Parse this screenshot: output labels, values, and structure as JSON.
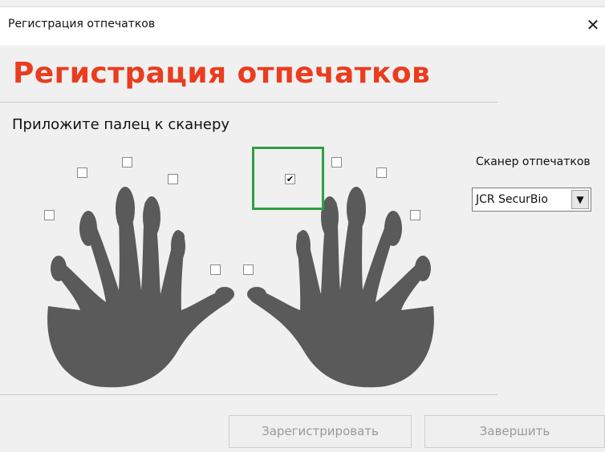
{
  "window": {
    "title": "Регистрация отпечатков",
    "close_glyph": "✕"
  },
  "header": {
    "title": "Регистрация отпечатков"
  },
  "prompt": "Приложите палец к сканеру",
  "scanner": {
    "label": "Сканер отпечатков",
    "selected": "JCR SecurBio",
    "arrow_glyph": "▼"
  },
  "fingers": {
    "left_little": false,
    "left_ring": false,
    "left_middle": false,
    "left_index": false,
    "left_thumb": false,
    "right_thumb": false,
    "right_index": true,
    "right_middle": false,
    "right_ring": false,
    "right_little": false,
    "check_glyph": "✔"
  },
  "buttons": {
    "register": "Зарегистрировать",
    "finish": "Завершить"
  },
  "colors": {
    "title": "#ea3c1e",
    "highlight": "#2ea043",
    "hand": "#5a5a5a"
  }
}
